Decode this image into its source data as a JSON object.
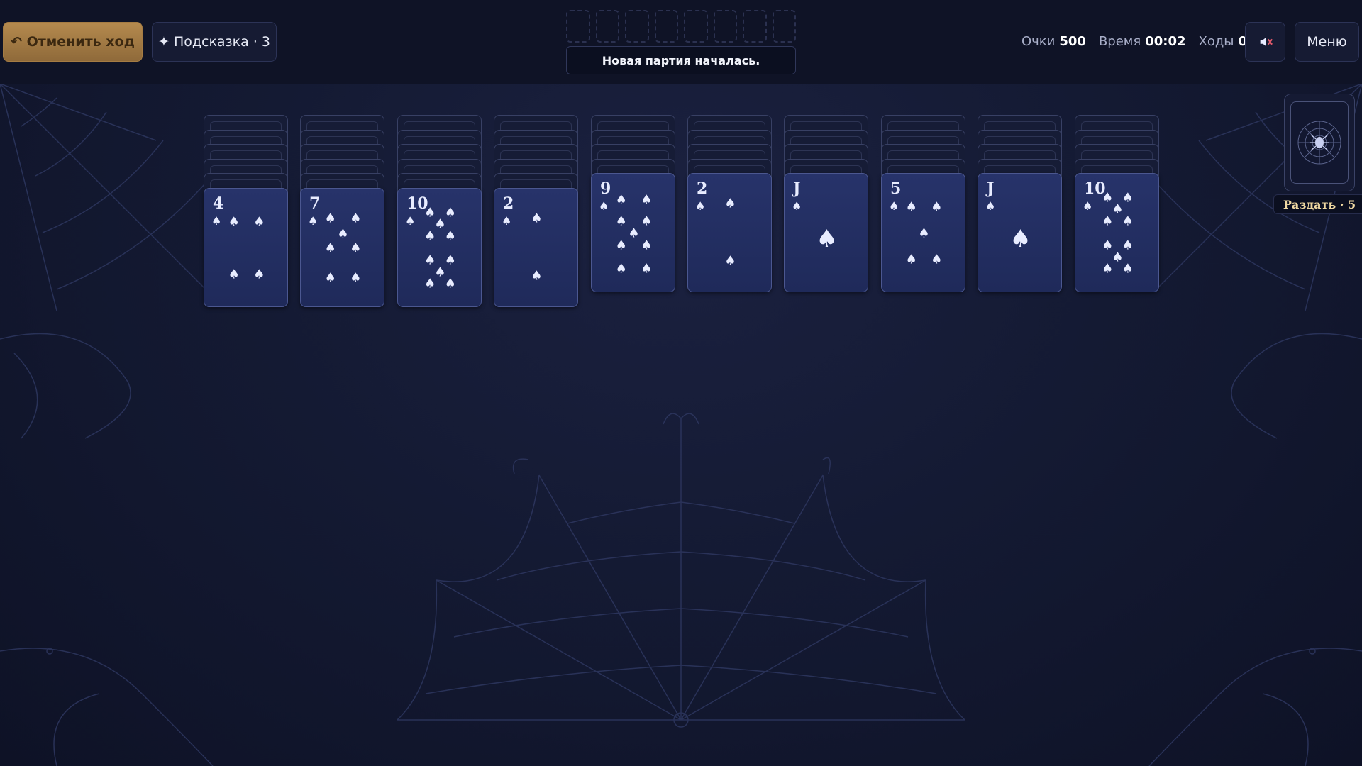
{
  "toolbar": {
    "undo_label": "↶ Отменить ход",
    "hint_label": "✦ Подсказка · 3",
    "menu_label": "Меню",
    "sound_icon": "muted-speaker-icon"
  },
  "status_message": "Новая партия началась.",
  "foundation_slots": 8,
  "stats": {
    "score_label": "Очки",
    "score": "500",
    "time_label": "Время",
    "time": "00:02",
    "moves_label": "Ходы",
    "moves": "0"
  },
  "stock": {
    "deal_label": "Раздать · 5"
  },
  "colors": {
    "accent_gold": "#b58a4e",
    "card_face": "#27336a",
    "background": "#141a33"
  },
  "tableau": [
    {
      "hidden": 5,
      "face_up": [
        {
          "rank": "4",
          "suit": "♠"
        }
      ]
    },
    {
      "hidden": 5,
      "face_up": [
        {
          "rank": "7",
          "suit": "♠"
        }
      ]
    },
    {
      "hidden": 5,
      "face_up": [
        {
          "rank": "10",
          "suit": "♠"
        }
      ]
    },
    {
      "hidden": 5,
      "face_up": [
        {
          "rank": "2",
          "suit": "♠"
        }
      ]
    },
    {
      "hidden": 4,
      "face_up": [
        {
          "rank": "9",
          "suit": "♠"
        }
      ]
    },
    {
      "hidden": 4,
      "face_up": [
        {
          "rank": "2",
          "suit": "♠"
        }
      ]
    },
    {
      "hidden": 4,
      "face_up": [
        {
          "rank": "J",
          "suit": "♠"
        }
      ]
    },
    {
      "hidden": 4,
      "face_up": [
        {
          "rank": "5",
          "suit": "♠"
        }
      ]
    },
    {
      "hidden": 4,
      "face_up": [
        {
          "rank": "J",
          "suit": "♠"
        }
      ]
    },
    {
      "hidden": 4,
      "face_up": [
        {
          "rank": "10",
          "suit": "♠"
        }
      ]
    }
  ]
}
